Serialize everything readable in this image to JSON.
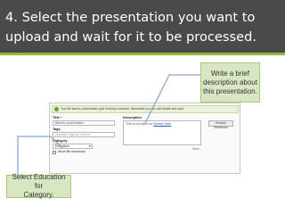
{
  "slide": {
    "title": "4. Select the presentation you want to\nupload and wait for it to be processed.",
    "colors": {
      "title_bar": "#4a4a4a",
      "accent": "#8dbb3c",
      "callout_fill": "#d8e6c2",
      "callout_border": "#aac67a",
      "connector": "#8ea7c8"
    }
  },
  "callouts": {
    "description": "Write a brief\ndescription about\nthis presentation.",
    "category": "Select Education for\nCategory."
  },
  "upload_form": {
    "notice": "Your file banner presentation.pptx is being converted. Meanwhile you can add details and save.",
    "notice_icon": "check-icon",
    "title_label": "Title *",
    "title_value": "Banner presentation",
    "tags_label": "Tags",
    "tags_placeholder": "separate tags by comma",
    "category_label": "Category",
    "category_value": "Education",
    "allow_download_label": "Allow file download",
    "description_label": "Description",
    "description_text": "This is a project for ",
    "description_link": "Banner Web",
    "save_label": "Save",
    "button_label": "Browse Slideshow"
  }
}
